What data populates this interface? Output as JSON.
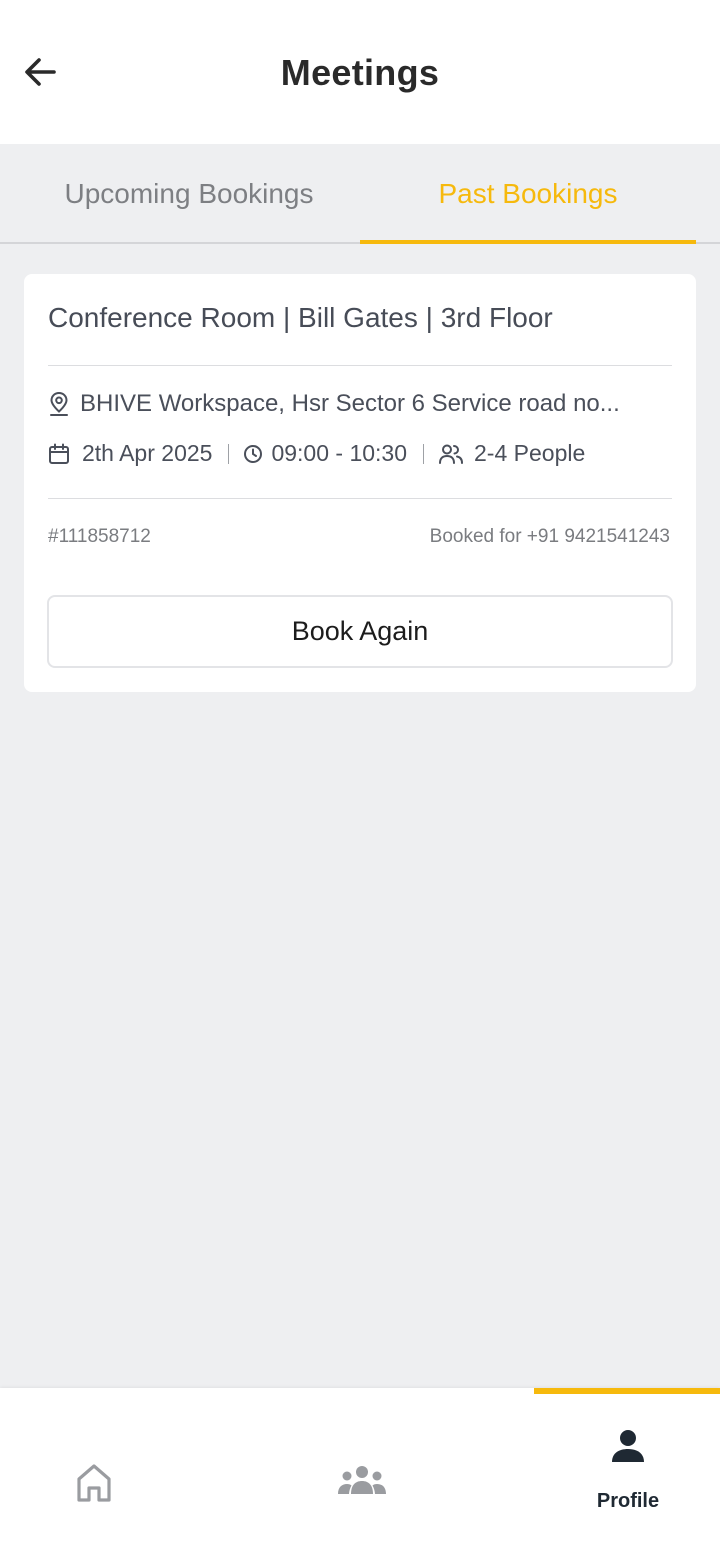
{
  "header": {
    "title": "Meetings",
    "back_icon": "arrow-left-icon"
  },
  "tabs": [
    {
      "label": "Upcoming Bookings",
      "active": false
    },
    {
      "label": "Past Bookings",
      "active": true
    }
  ],
  "booking": {
    "room": "Conference Room | Bill Gates | 3rd Floor",
    "address": "BHIVE Workspace, Hsr Sector 6 Service road no...",
    "date": "2th Apr 2025",
    "time": "09:00 - 10:30",
    "capacity": "2-4 People",
    "booking_id": "#111858712",
    "booked_for": "Booked for +91 9421541243",
    "action_label": "Book Again"
  },
  "bottom_nav": {
    "items": [
      {
        "icon": "home-icon",
        "active": false
      },
      {
        "icon": "community-icon",
        "active": false
      },
      {
        "icon": "profile-icon",
        "label": "Profile",
        "active": true
      }
    ]
  },
  "colors": {
    "accent": "#f6b90d",
    "background": "#eeeff1",
    "text_primary": "#2a2a2a",
    "text_secondary": "#4a4f5a",
    "text_muted": "#7d7f83"
  }
}
